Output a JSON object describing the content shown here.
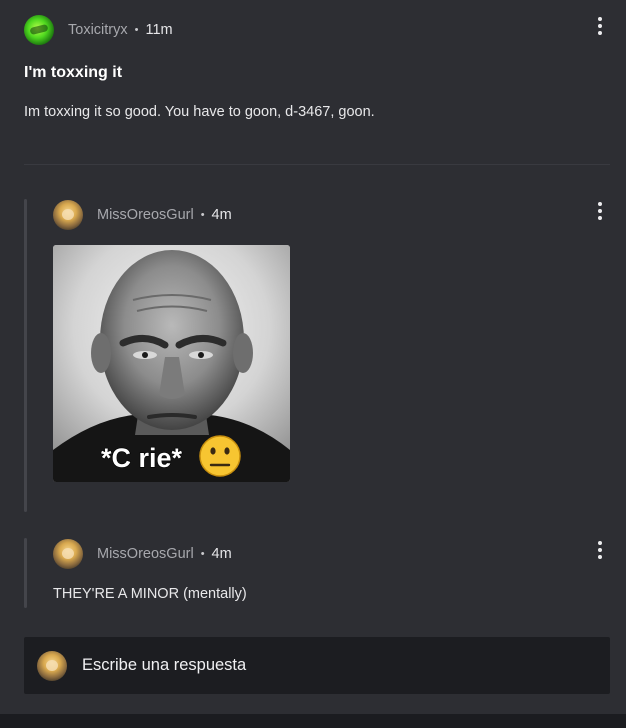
{
  "post": {
    "author": "Toxicitryx",
    "separator": "•",
    "time": "11m",
    "title": "I'm toxxing it",
    "body": "Im toxxing it so good. You have to goon, d-3467, goon."
  },
  "comments": [
    {
      "author": "MissOreosGurl",
      "separator": "•",
      "time": "4m",
      "image_caption": "*C rie*"
    },
    {
      "author": "MissOreosGurl",
      "separator": "•",
      "time": "4m",
      "text": "THEY'RE A MINOR (mentally)"
    }
  ],
  "reply": {
    "placeholder": "Escribe una respuesta"
  },
  "colors": {
    "card_background": "#2d2e33",
    "page_background": "#1b1c20",
    "reply_background": "#1c1d21",
    "thread_line": "#44454b",
    "username": "#a7a8ad"
  },
  "icons": {
    "post_menu": "more-vertical-icon",
    "comment_menu": "more-vertical-icon",
    "image_emoji": "neutral-face-icon"
  }
}
